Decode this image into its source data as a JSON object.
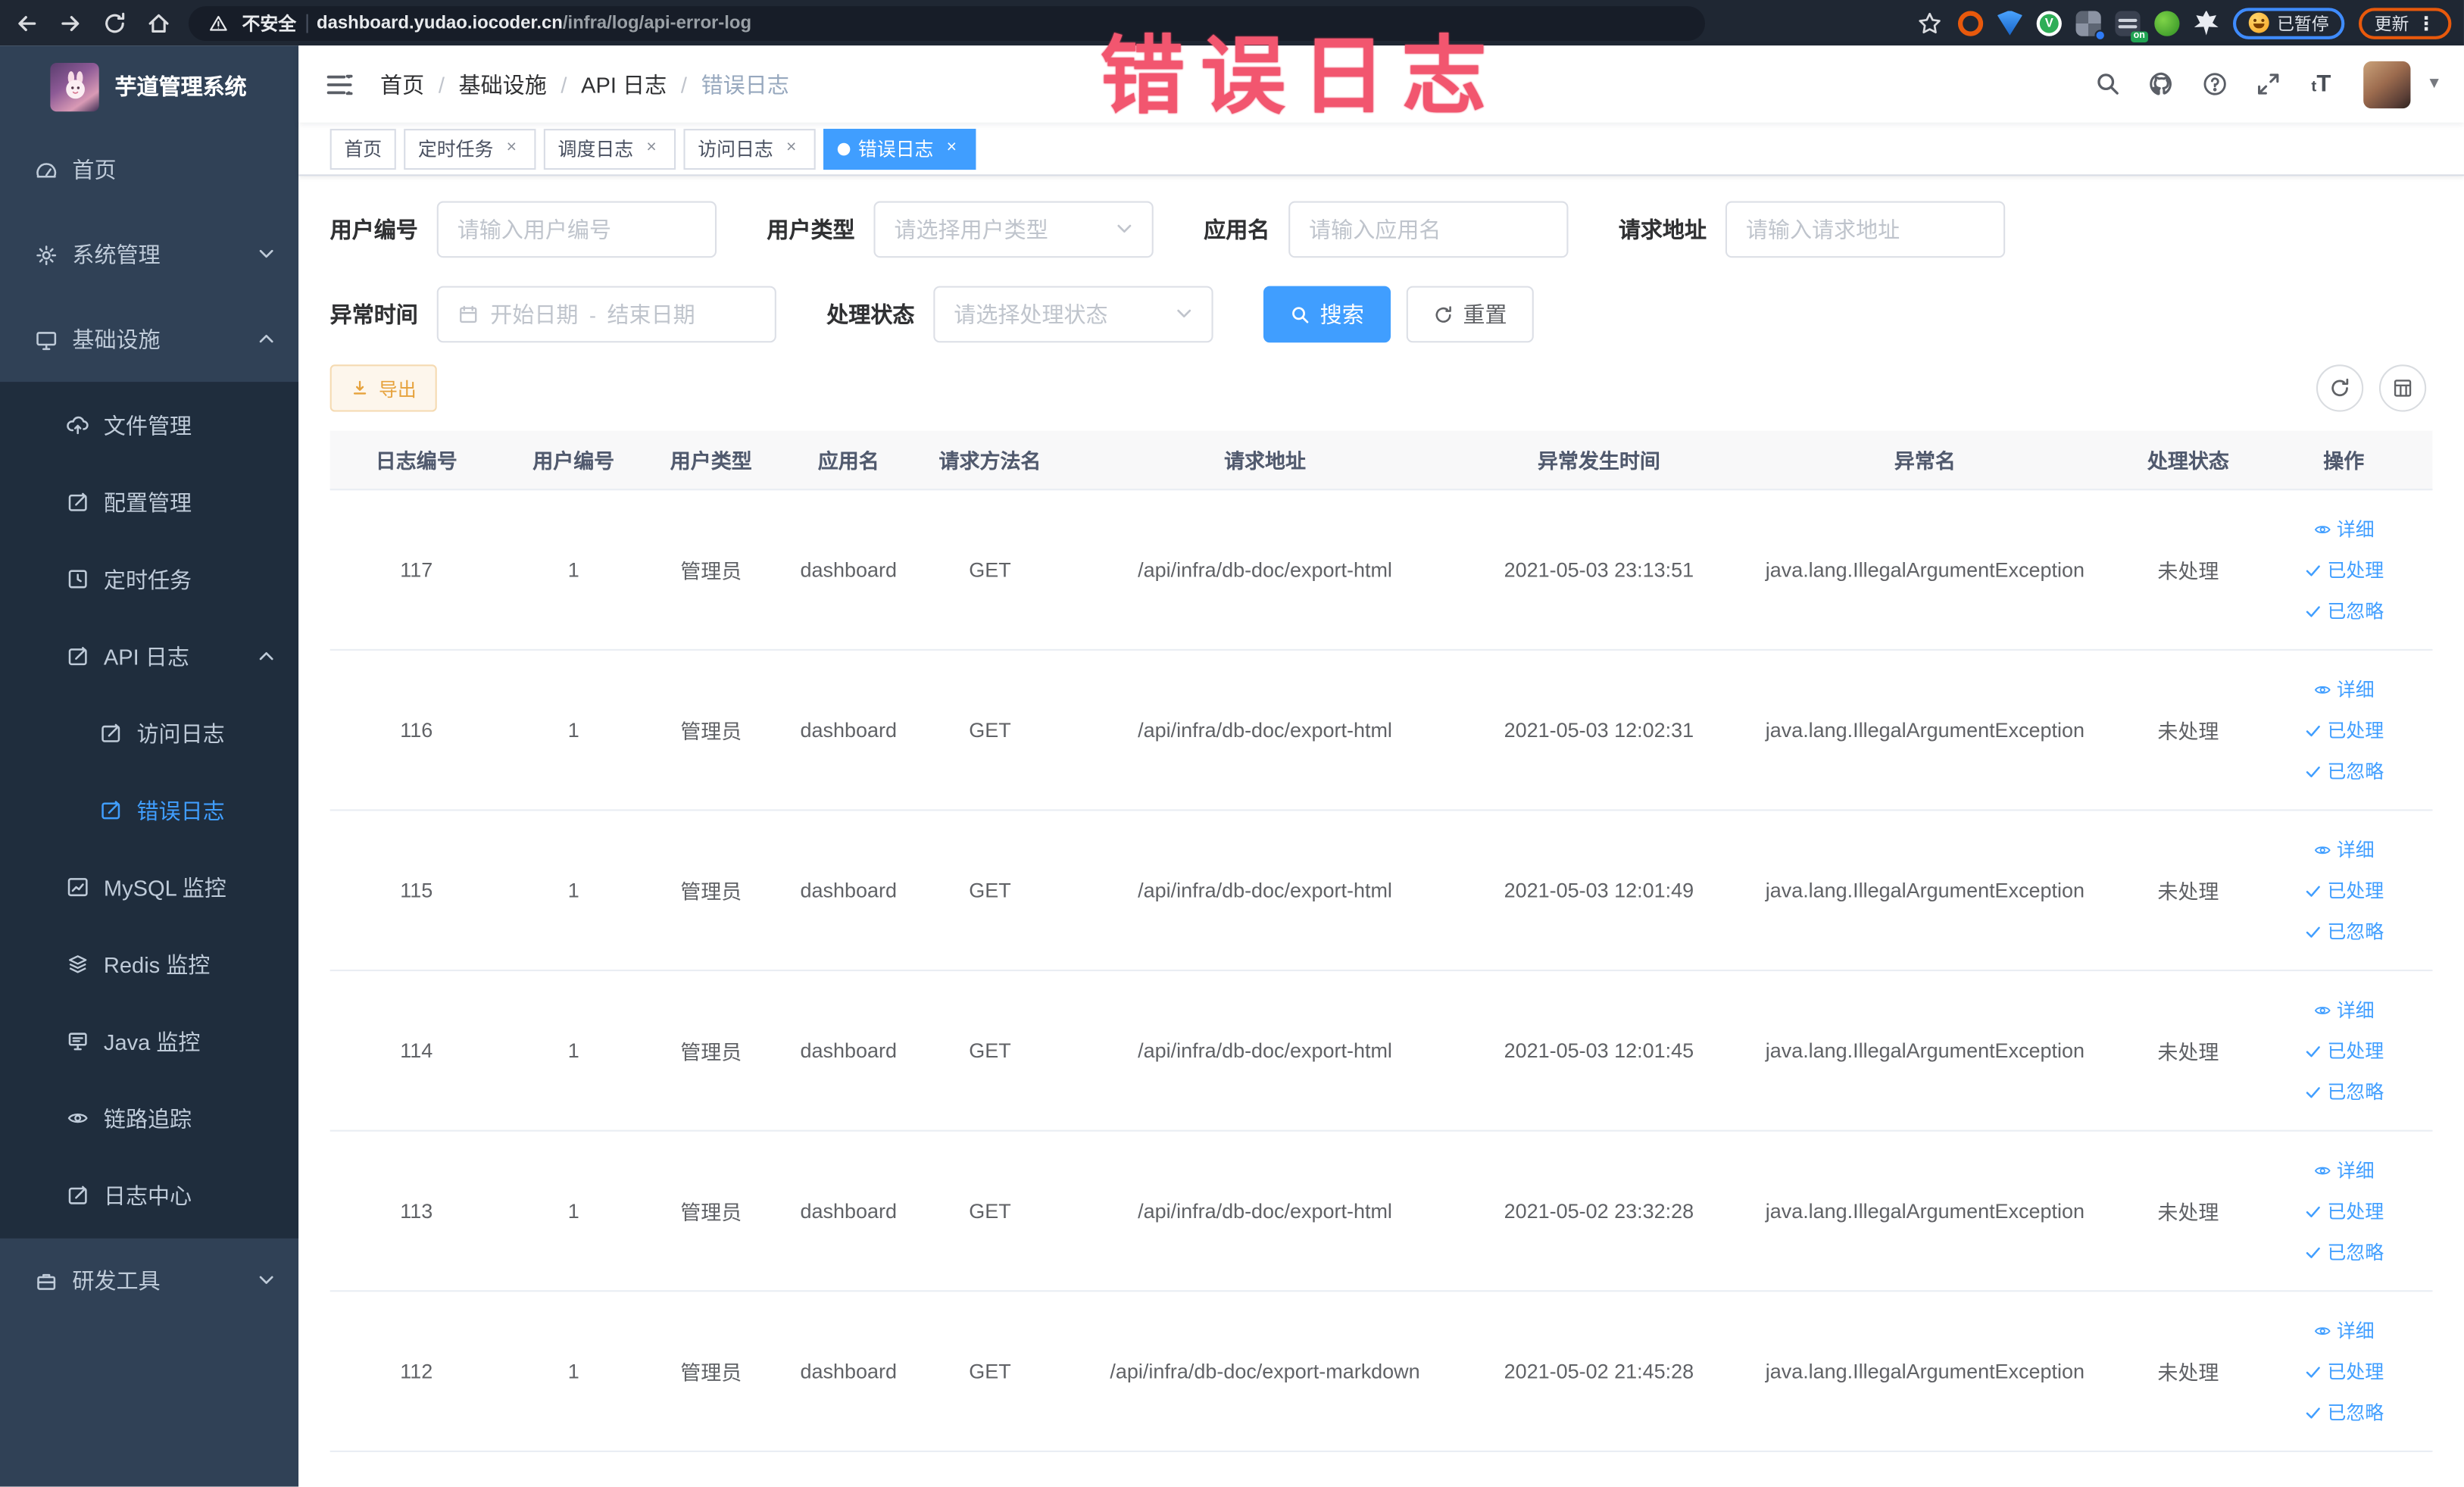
{
  "browser": {
    "security_label": "不安全",
    "url_domain": "dashboard.yudao.iocoder.cn",
    "url_path": "/infra/log/api-error-log",
    "extension_badge": "on",
    "paused_badge": "已暂停",
    "update_button": "更新",
    "kebab": "⋮"
  },
  "watermark": "错误日志",
  "sidebar": {
    "title": "芋道管理系统",
    "menu": [
      {
        "label": "首页"
      },
      {
        "label": "系统管理"
      },
      {
        "label": "基础设施"
      },
      {
        "label": "文件管理"
      },
      {
        "label": "配置管理"
      },
      {
        "label": "定时任务"
      },
      {
        "label": "API 日志"
      },
      {
        "label": "访问日志"
      },
      {
        "label": "错误日志"
      },
      {
        "label": "MySQL 监控"
      },
      {
        "label": "Redis 监控"
      },
      {
        "label": "Java 监控"
      },
      {
        "label": "链路追踪"
      },
      {
        "label": "日志中心"
      },
      {
        "label": "研发工具"
      }
    ]
  },
  "header": {
    "breadcrumb": [
      "首页",
      "基础设施",
      "API 日志",
      "错误日志"
    ],
    "breadcrumb_separator": "/"
  },
  "tags": [
    {
      "label": "首页"
    },
    {
      "label": "定时任务"
    },
    {
      "label": "调度日志"
    },
    {
      "label": "访问日志"
    },
    {
      "label": "错误日志"
    }
  ],
  "tag_close_glyph": "×",
  "filters": {
    "user_id": {
      "label": "用户编号",
      "placeholder": "请输入用户编号"
    },
    "user_type": {
      "label": "用户类型",
      "placeholder": "请选择用户类型"
    },
    "app_name": {
      "label": "应用名",
      "placeholder": "请输入应用名"
    },
    "request_url": {
      "label": "请求地址",
      "placeholder": "请输入请求地址"
    },
    "exception_time": {
      "label": "异常时间",
      "start_placeholder": "开始日期",
      "separator": "-",
      "end_placeholder": "结束日期"
    },
    "process_status": {
      "label": "处理状态",
      "placeholder": "请选择处理状态"
    },
    "search_label": "搜索",
    "reset_label": "重置"
  },
  "toolbar": {
    "export_label": "导出"
  },
  "table": {
    "headers": [
      "日志编号",
      "用户编号",
      "用户类型",
      "应用名",
      "请求方法名",
      "请求地址",
      "异常发生时间",
      "异常名",
      "处理状态",
      "操作"
    ],
    "actions": {
      "detail": "详细",
      "processed": "已处理",
      "ignored": "已忽略"
    },
    "rows": [
      {
        "id": "117",
        "user_id": "1",
        "user_type": "管理员",
        "app": "dashboard",
        "method": "GET",
        "url": "/api/infra/db-doc/export-html",
        "time": "2021-05-03 23:13:51",
        "exception": "java.lang.IllegalArgumentException",
        "status": "未处理"
      },
      {
        "id": "116",
        "user_id": "1",
        "user_type": "管理员",
        "app": "dashboard",
        "method": "GET",
        "url": "/api/infra/db-doc/export-html",
        "time": "2021-05-03 12:02:31",
        "exception": "java.lang.IllegalArgumentException",
        "status": "未处理"
      },
      {
        "id": "115",
        "user_id": "1",
        "user_type": "管理员",
        "app": "dashboard",
        "method": "GET",
        "url": "/api/infra/db-doc/export-html",
        "time": "2021-05-03 12:01:49",
        "exception": "java.lang.IllegalArgumentException",
        "status": "未处理"
      },
      {
        "id": "114",
        "user_id": "1",
        "user_type": "管理员",
        "app": "dashboard",
        "method": "GET",
        "url": "/api/infra/db-doc/export-html",
        "time": "2021-05-03 12:01:45",
        "exception": "java.lang.IllegalArgumentException",
        "status": "未处理"
      },
      {
        "id": "113",
        "user_id": "1",
        "user_type": "管理员",
        "app": "dashboard",
        "method": "GET",
        "url": "/api/infra/db-doc/export-html",
        "time": "2021-05-02 23:32:28",
        "exception": "java.lang.IllegalArgumentException",
        "status": "未处理"
      },
      {
        "id": "112",
        "user_id": "1",
        "user_type": "管理员",
        "app": "dashboard",
        "method": "GET",
        "url": "/api/infra/db-doc/export-markdown",
        "time": "2021-05-02 21:45:28",
        "exception": "java.lang.IllegalArgumentException",
        "status": "未处理"
      }
    ]
  },
  "colors": {
    "accent": "#409eff",
    "sidebar_bg": "#304156",
    "submenu_bg": "#1f2d3d",
    "warning": "#e6a23c",
    "watermark": "#f2566f"
  }
}
